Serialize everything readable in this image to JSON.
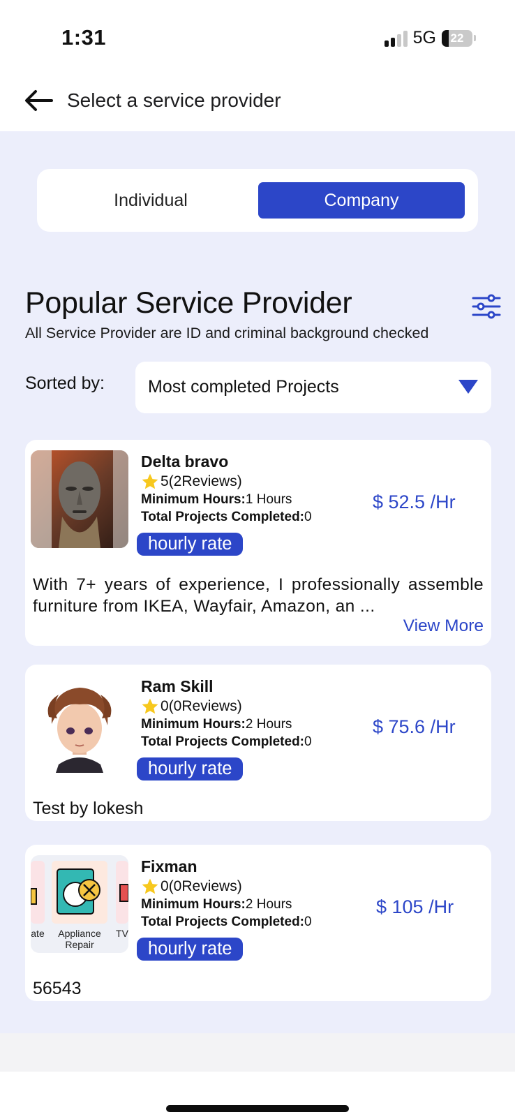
{
  "status_bar": {
    "time": "1:31",
    "network": "5G",
    "battery": "22",
    "battery_level": 0.22
  },
  "header": {
    "back_icon": "arrow-left-icon",
    "title": "Select a service provider"
  },
  "segmented_control": {
    "individual_label": "Individual",
    "company_label": "Company",
    "selected": "Company"
  },
  "section": {
    "title": "Popular Service Provider",
    "subtitle": "All Service Provider are ID and criminal background checked",
    "filter_icon": "sliders-icon"
  },
  "sort": {
    "label": "Sorted by:",
    "value": "Most completed Projects",
    "arrow_icon": "triangle-down-icon"
  },
  "providers": [
    {
      "name": "Delta bravo",
      "rating": "5",
      "reviews": "(2Reviews)",
      "min_hours_label": "Minimum Hours:",
      "min_hours_value": "1 Hours",
      "total_label": "Total Projects Completed:",
      "total_value": "0",
      "badge": "hourly rate",
      "price": "$ 52.5 /Hr",
      "description": "With 7+ years of experience, I professionally assemble furniture from IKEA, Wayfair, Amazon, an ...",
      "view_more": "View More"
    },
    {
      "name": "Ram Skill",
      "rating": "0",
      "reviews": "(0Reviews)",
      "min_hours_label": "Minimum Hours:",
      "min_hours_value": "2 Hours",
      "total_label": "Total Projects Completed:",
      "total_value": "0",
      "badge": "hourly rate",
      "price": "$ 75.6 /Hr",
      "description": "Test by lokesh"
    },
    {
      "name": "Fixman",
      "rating": "0",
      "reviews": "(0Reviews)",
      "min_hours_label": "Minimum Hours:",
      "min_hours_value": "2 Hours",
      "total_label": "Total Projects Completed:",
      "total_value": "0",
      "badge": "hourly rate",
      "price": "$ 105 /Hr",
      "description": "56543",
      "thumb_captions": {
        "left": "ate",
        "center": "Appliance Repair",
        "right": "TV"
      }
    }
  ],
  "colors": {
    "accent": "#2c46c8",
    "page_bg": "#eceefb",
    "star": "#f7c81e"
  }
}
